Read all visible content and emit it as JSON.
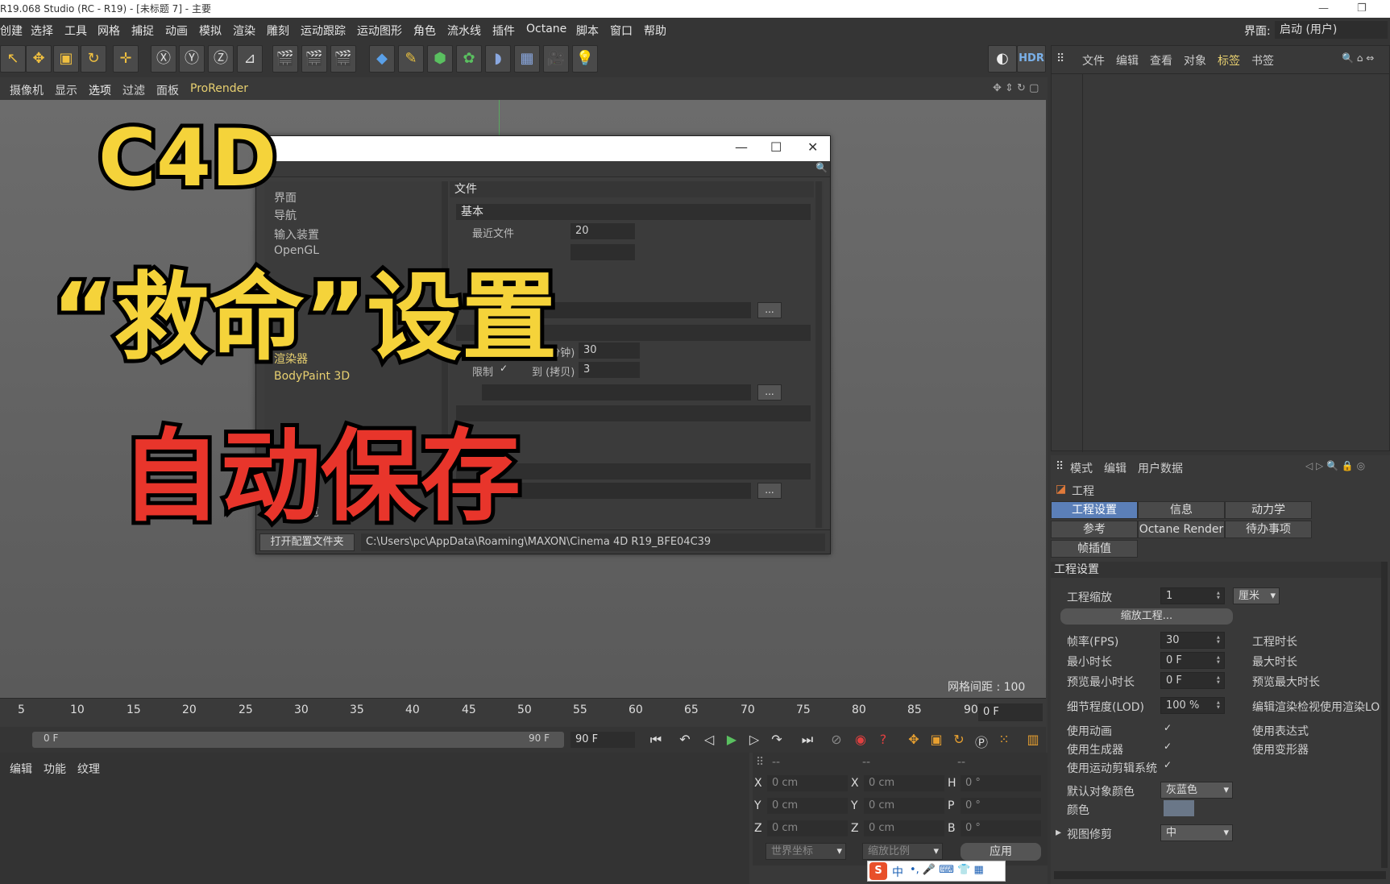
{
  "window": {
    "title": "R19.068 Studio (RC - R19) - [未标题 7] - 主要"
  },
  "menu": [
    "创建",
    "选择",
    "工具",
    "网格",
    "捕捉",
    "动画",
    "模拟",
    "渲染",
    "雕刻",
    "运动跟踪",
    "运动图形",
    "角色",
    "流水线",
    "插件",
    "Octane",
    "脚本",
    "窗口",
    "帮助"
  ],
  "interface": {
    "label": "界面:",
    "value": "启动 (用户)"
  },
  "viewport_menu": [
    "摄像机",
    "显示",
    "选项",
    "过滤",
    "面板",
    "ProRender"
  ],
  "viewport": {
    "grid_spacing": "网格间距 : 100 cm"
  },
  "overlay": {
    "line1": "C4D",
    "line2": "“救命”设置",
    "line3": "自动保存"
  },
  "object_manager": {
    "menu": [
      "文件",
      "编辑",
      "查看",
      "对象",
      "标签",
      "书签"
    ]
  },
  "attr_manager": {
    "menu": [
      "模式",
      "编辑",
      "用户数据"
    ],
    "object": "工程",
    "tabs": [
      "工程设置",
      "信息",
      "动力学",
      "参考",
      "Octane Render",
      "待办事项",
      "帧插值"
    ],
    "section": "工程设置",
    "scale_label": "工程缩放",
    "scale_value": "1",
    "scale_unit": "厘米",
    "scale_button": "缩放工程...",
    "fps_label": "帧率(FPS)",
    "fps_value": "30",
    "duration_label": "工程时长",
    "min_label": "最小时长",
    "min_value": "0 F",
    "max_label": "最大时长",
    "pmin_label": "预览最小时长",
    "pmin_value": "0 F",
    "pmax_label": "预览最大时长",
    "lod_label": "细节程度(LOD)",
    "lod_value": "100 %",
    "lod_right": "编辑渲染检视使用渲染LO",
    "use_anim": "使用动画",
    "use_expr": "使用表达式",
    "use_gen": "使用生成器",
    "use_deform": "使用变形器",
    "use_motion": "使用运动剪辑系统",
    "def_color_label": "默认对象颜色",
    "def_color_value": "灰蓝色",
    "color_label": "颜色",
    "view_clip_label": "视图修剪",
    "view_clip_value": "中"
  },
  "timeline": {
    "ticks": [
      "5",
      "10",
      "15",
      "20",
      "25",
      "30",
      "35",
      "40",
      "45",
      "50",
      "55",
      "60",
      "65",
      "70",
      "75",
      "80",
      "85",
      "90"
    ],
    "frame": "0 F"
  },
  "transport": {
    "start": "0 F",
    "end": "90 F",
    "end2": "90 F"
  },
  "material": {
    "menu": [
      "编辑",
      "功能",
      "纹理"
    ]
  },
  "coords": {
    "header": [
      "--",
      "--",
      "--"
    ],
    "rows": [
      {
        "a": "X",
        "av": "0 cm",
        "b": "X",
        "bv": "0 cm",
        "c": "H",
        "cv": "0 °"
      },
      {
        "a": "Y",
        "av": "0 cm",
        "b": "Y",
        "bv": "0 cm",
        "c": "P",
        "cv": "0 °"
      },
      {
        "a": "Z",
        "av": "0 cm",
        "b": "Z",
        "bv": "0 cm",
        "c": "B",
        "cv": "0 °"
      }
    ],
    "world": "世界坐标",
    "scale": "缩放比例",
    "apply": "应用"
  },
  "dialog": {
    "left_items": [
      "界面",
      "导航",
      "输入装置",
      "OpenGL",
      "渲染器",
      "BodyPaint 3D",
      "材质预览"
    ],
    "file_section": "文件",
    "basic": "基本",
    "recent_label": "最近文件",
    "recent_value": "20",
    "autosave_label": "保存",
    "every_label": "每 (分钟)",
    "every_value": "30",
    "limit_label": "限制",
    "copies_label": "到 (拷贝)",
    "copies_value": "3",
    "path_label": "路径",
    "browse": "...",
    "open_folder": "打开配置文件夹",
    "config_path": "C:\\Users\\pc\\AppData\\Roaming\\MAXON\\Cinema 4D R19_BFE04C39"
  },
  "ime": {
    "lang": "中"
  }
}
